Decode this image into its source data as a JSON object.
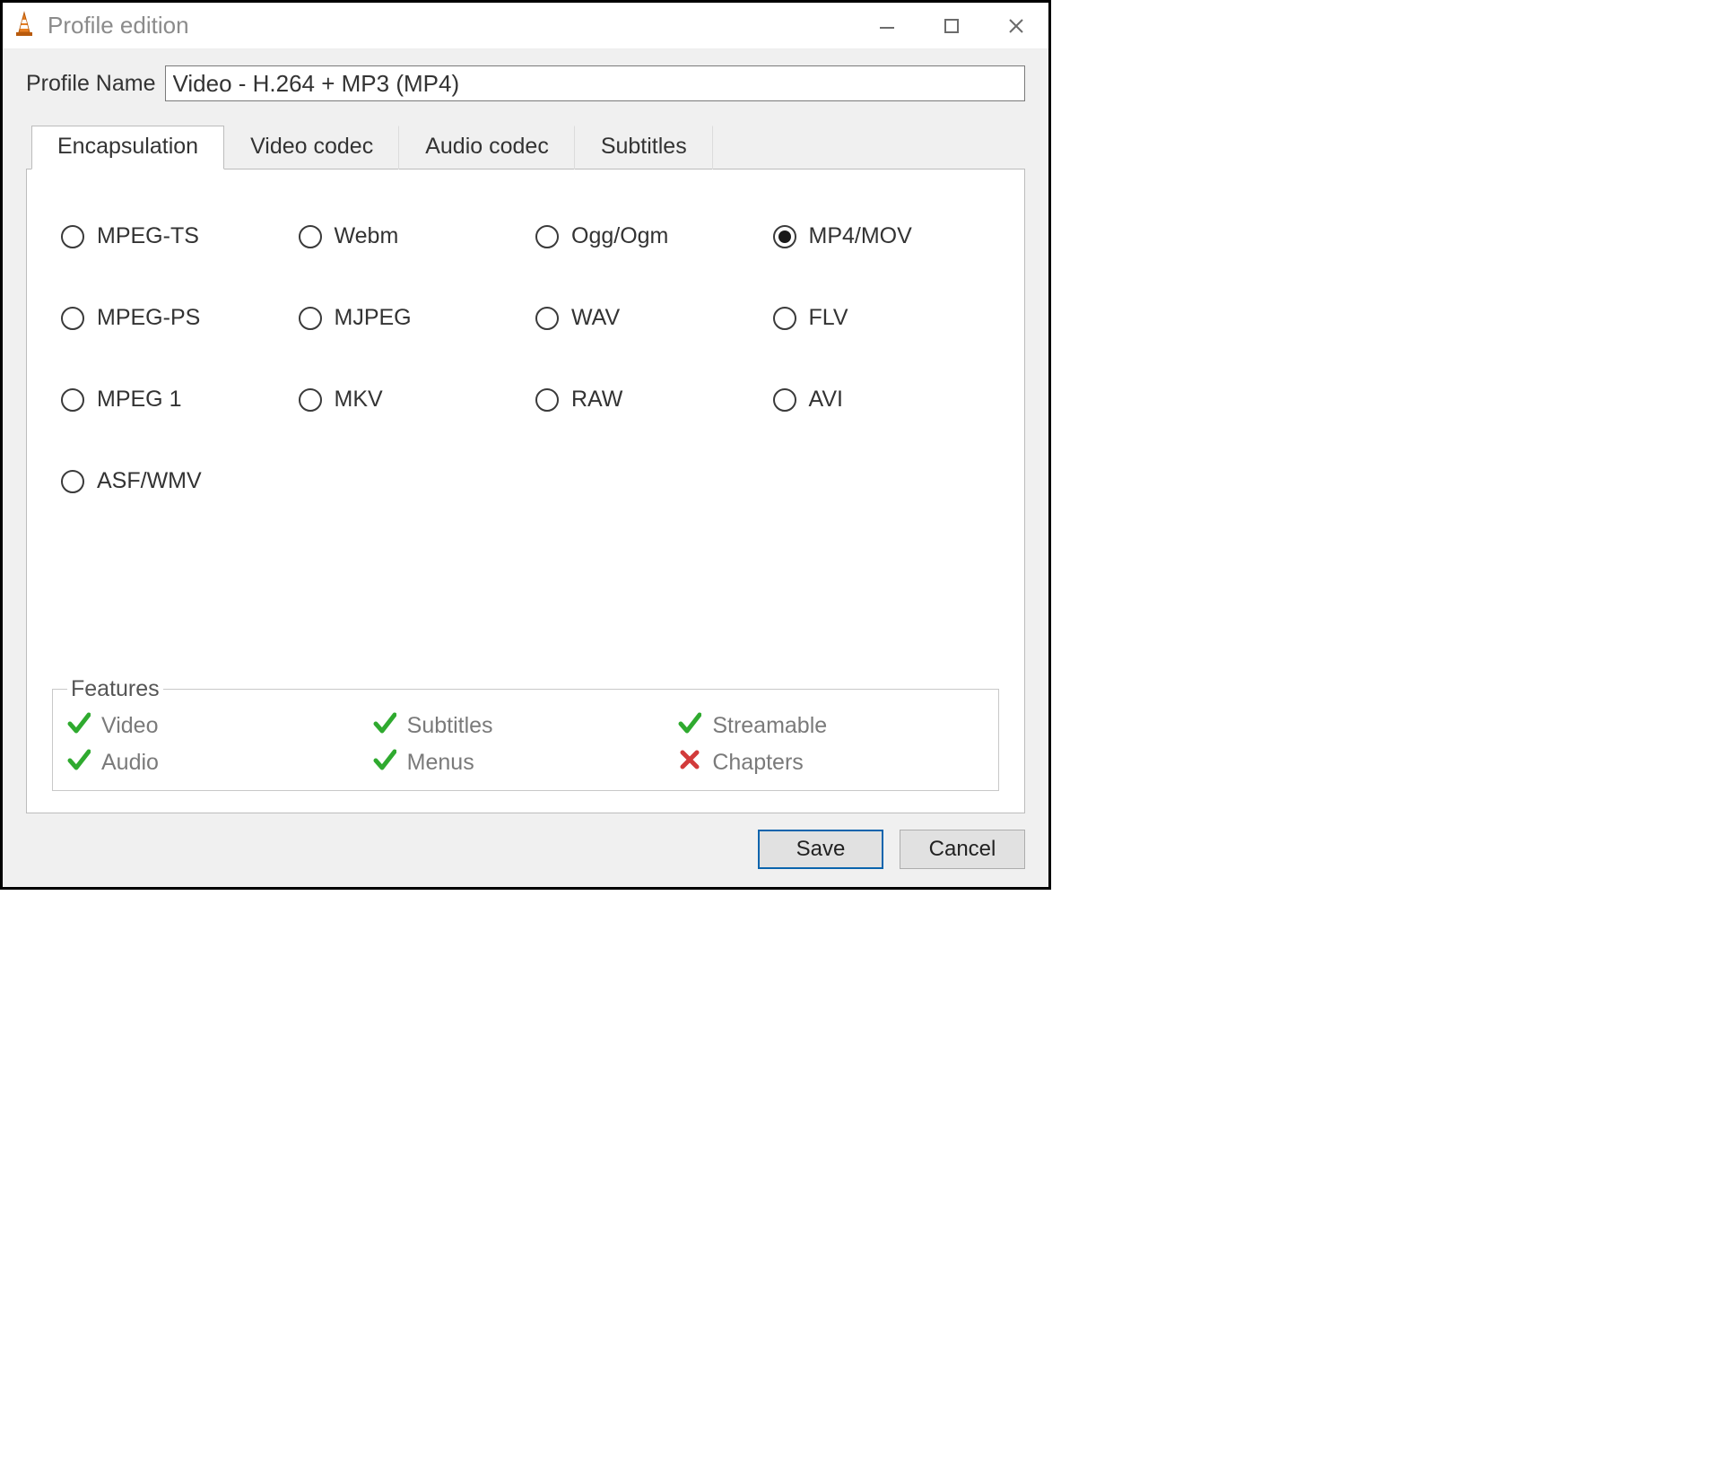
{
  "window": {
    "title": "Profile edition"
  },
  "profile": {
    "name_label": "Profile Name",
    "name_value": "Video - H.264 + MP3 (MP4)"
  },
  "tabs": [
    {
      "id": "encapsulation",
      "label": "Encapsulation",
      "active": true
    },
    {
      "id": "video-codec",
      "label": "Video codec",
      "active": false
    },
    {
      "id": "audio-codec",
      "label": "Audio codec",
      "active": false
    },
    {
      "id": "subtitles",
      "label": "Subtitles",
      "active": false
    }
  ],
  "encapsulation": {
    "options": [
      {
        "id": "mpeg-ts",
        "label": "MPEG-TS",
        "selected": false
      },
      {
        "id": "webm",
        "label": "Webm",
        "selected": false
      },
      {
        "id": "ogg-ogm",
        "label": "Ogg/Ogm",
        "selected": false
      },
      {
        "id": "mp4-mov",
        "label": "MP4/MOV",
        "selected": true
      },
      {
        "id": "mpeg-ps",
        "label": "MPEG-PS",
        "selected": false
      },
      {
        "id": "mjpeg",
        "label": "MJPEG",
        "selected": false
      },
      {
        "id": "wav",
        "label": "WAV",
        "selected": false
      },
      {
        "id": "flv",
        "label": "FLV",
        "selected": false
      },
      {
        "id": "mpeg-1",
        "label": "MPEG 1",
        "selected": false
      },
      {
        "id": "mkv",
        "label": "MKV",
        "selected": false
      },
      {
        "id": "raw",
        "label": "RAW",
        "selected": false
      },
      {
        "id": "avi",
        "label": "AVI",
        "selected": false
      },
      {
        "id": "asf-wmv",
        "label": "ASF/WMV",
        "selected": false
      }
    ]
  },
  "features": {
    "legend": "Features",
    "items": [
      {
        "id": "video",
        "label": "Video",
        "supported": true
      },
      {
        "id": "subtitles",
        "label": "Subtitles",
        "supported": true
      },
      {
        "id": "streamable",
        "label": "Streamable",
        "supported": true
      },
      {
        "id": "audio",
        "label": "Audio",
        "supported": true
      },
      {
        "id": "menus",
        "label": "Menus",
        "supported": true
      },
      {
        "id": "chapters",
        "label": "Chapters",
        "supported": false
      }
    ]
  },
  "buttons": {
    "save_label": "Save",
    "cancel_label": "Cancel"
  }
}
